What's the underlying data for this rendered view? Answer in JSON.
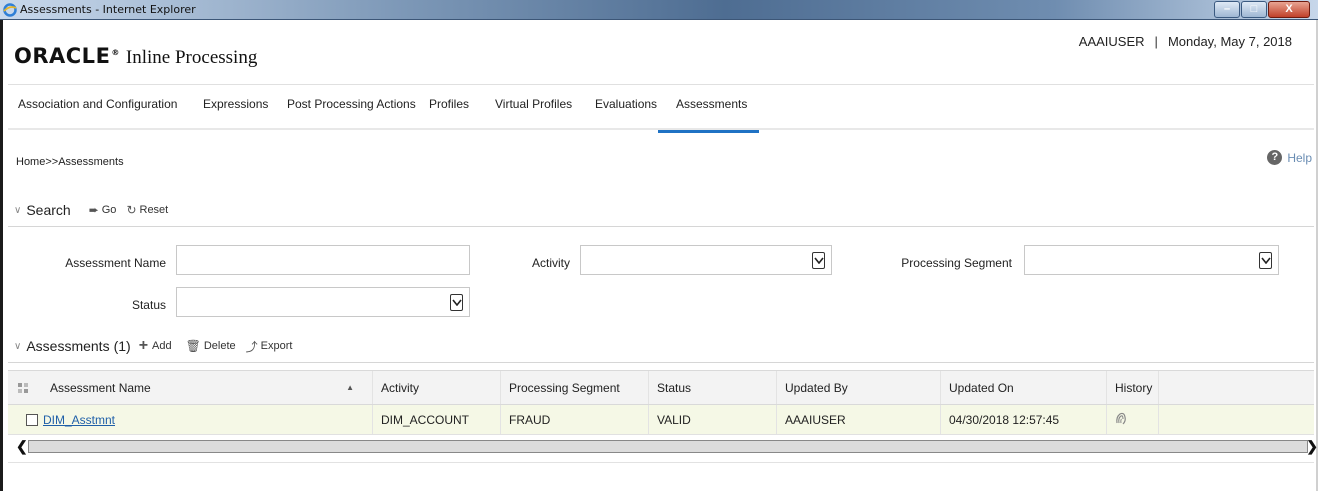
{
  "window": {
    "title": "Assessments - Internet Explorer",
    "minimize_glyph": "–",
    "maximize_glyph": "□",
    "close_glyph": "X"
  },
  "header": {
    "logo_text": "ORACLE",
    "logo_mark": "®",
    "app_name": "Inline Processing",
    "user": "AAAIUSER",
    "separator": "|",
    "date": "Monday, May 7, 2018"
  },
  "nav": {
    "tabs": [
      {
        "label": "Association and Configuration"
      },
      {
        "label": "Expressions"
      },
      {
        "label": "Post Processing Actions"
      },
      {
        "label": "Profiles"
      },
      {
        "label": "Virtual Profiles"
      },
      {
        "label": "Evaluations"
      },
      {
        "label": "Assessments",
        "active": true
      }
    ]
  },
  "breadcrumb": "Home>>Assessments",
  "help": {
    "icon": "?",
    "label": "Help"
  },
  "search": {
    "title": "Search",
    "go_label": "Go",
    "reset_label": "Reset",
    "fields": {
      "assessment_name_label": "Assessment Name",
      "assessment_name_value": "",
      "activity_label": "Activity",
      "activity_value": "",
      "processing_segment_label": "Processing Segment",
      "processing_segment_value": "",
      "status_label": "Status",
      "status_value": ""
    }
  },
  "assessments": {
    "title": "Assessments",
    "count": "(1)",
    "add_label": "Add",
    "delete_label": "Delete",
    "export_label": "Export",
    "columns": [
      "Assessment Name",
      "Activity",
      "Processing Segment",
      "Status",
      "Updated By",
      "Updated On",
      "History"
    ],
    "rows": [
      {
        "assessment_name": "DIM_Asstmnt",
        "activity": "DIM_ACCOUNT",
        "processing_segment": "FRAUD",
        "status": "VALID",
        "updated_by": "AAAIUSER",
        "updated_on": "04/30/2018 12:57:45"
      }
    ]
  },
  "colors": {
    "accent": "#1f72c4",
    "link": "#1f5fa8",
    "row_highlight": "#f5f8e6",
    "help": "#6a8db3"
  }
}
